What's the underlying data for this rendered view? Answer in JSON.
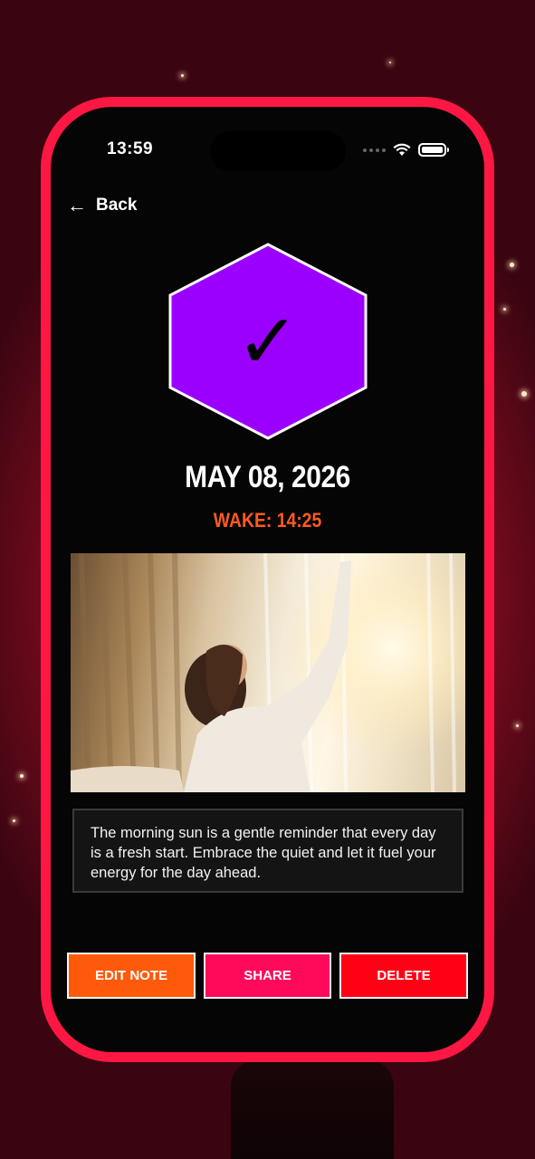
{
  "status_bar": {
    "time": "13:59"
  },
  "nav": {
    "back_label": "Back",
    "back_icon": "arrow-left-icon"
  },
  "badge": {
    "icon": "checkmark-icon",
    "glyph": "✓",
    "color": "#9b00ff"
  },
  "entry": {
    "date": "MAY 08, 2026",
    "wake": "WAKE: 14:25"
  },
  "photo": {
    "description": "woman stretching by curtained window at sunrise"
  },
  "note": {
    "text": "The morning sun is a gentle reminder that every day is a fresh start. Embrace the quiet and let it fuel your energy for the day ahead."
  },
  "actions": {
    "edit_label": "EDIT NOTE",
    "share_label": "SHARE",
    "delete_label": "DELETE"
  },
  "colors": {
    "accent": "#ff1744",
    "wake": "#ff5a1f",
    "edit": "#ff5a0a",
    "share": "#ff0a5a",
    "delete": "#ff0015",
    "badge": "#9b00ff"
  }
}
